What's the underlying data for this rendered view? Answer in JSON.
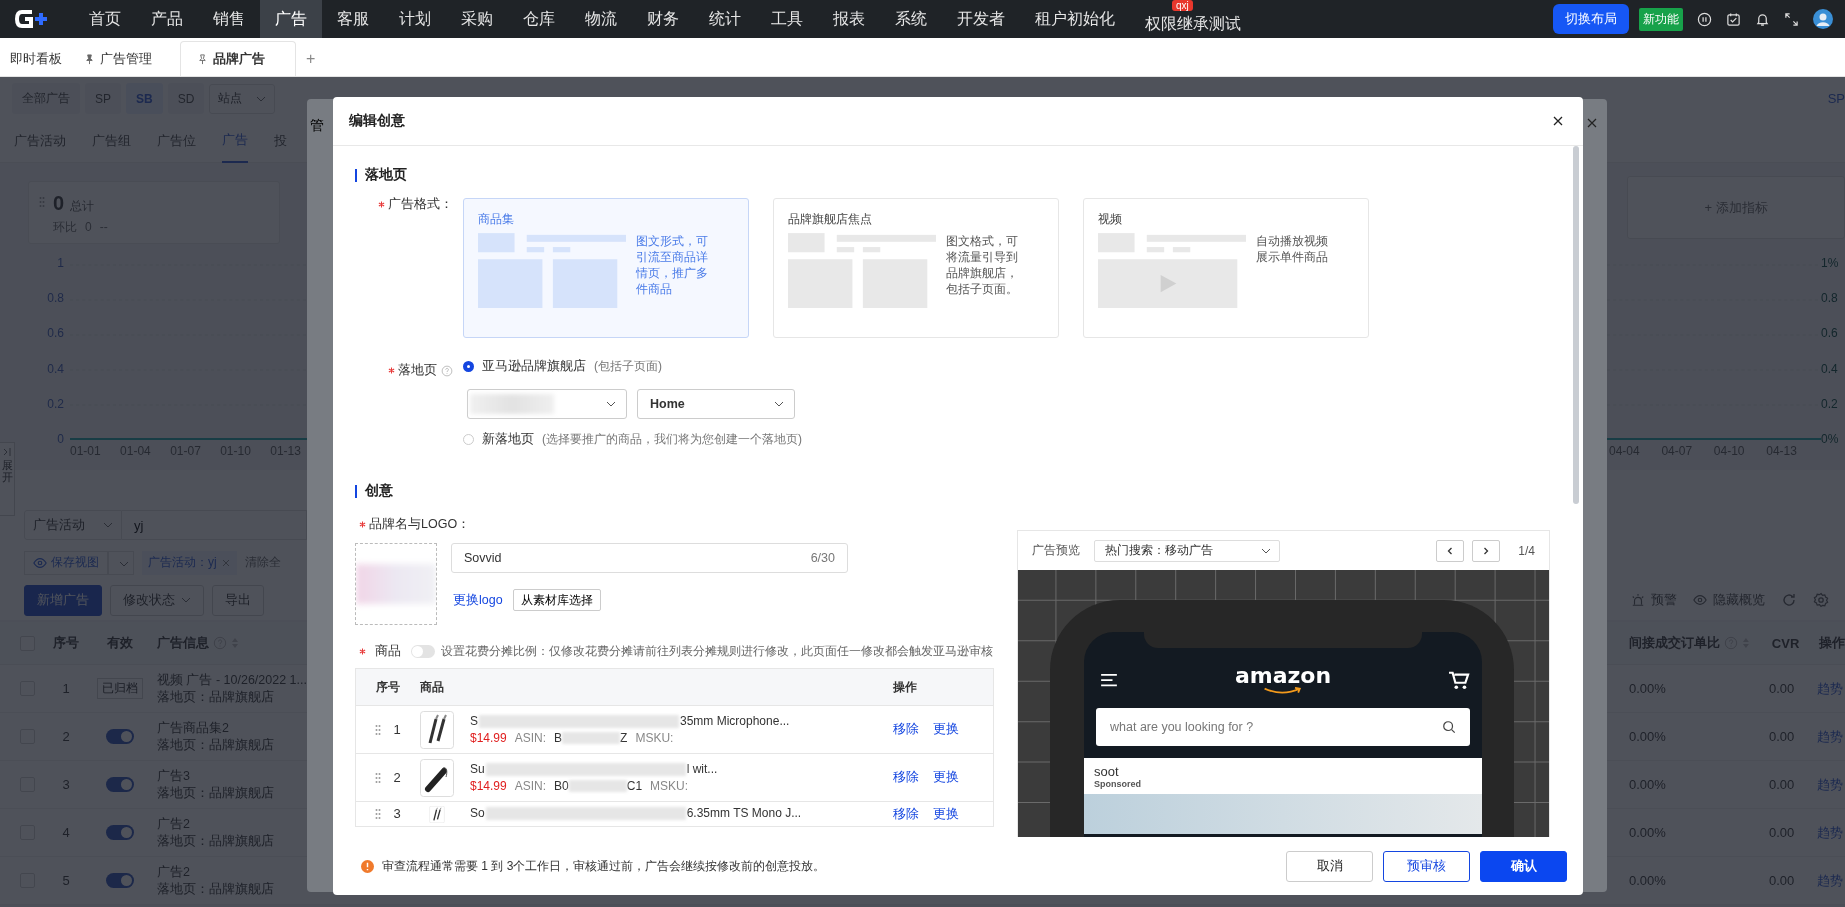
{
  "top_nav": {
    "items": [
      {
        "label": "首页",
        "selected": false
      },
      {
        "label": "产品",
        "selected": false
      },
      {
        "label": "销售",
        "selected": false
      },
      {
        "label": "广告",
        "selected": true
      },
      {
        "label": "客服",
        "selected": false
      },
      {
        "label": "计划",
        "selected": false
      },
      {
        "label": "采购",
        "selected": false
      },
      {
        "label": "仓库",
        "selected": false
      },
      {
        "label": "物流",
        "selected": false
      },
      {
        "label": "财务",
        "selected": false
      },
      {
        "label": "统计",
        "selected": false
      },
      {
        "label": "工具",
        "selected": false
      },
      {
        "label": "报表",
        "selected": false
      },
      {
        "label": "系统",
        "selected": false
      },
      {
        "label": "开发者",
        "selected": false
      },
      {
        "label": "租户初始化",
        "selected": false
      },
      {
        "label": "权限继承测试",
        "selected": false,
        "badge": "qxj"
      }
    ],
    "switch_layout": "切换布局",
    "new_feature": "新功能"
  },
  "page_tabs": [
    {
      "label": "即时看板",
      "pinned": false,
      "selected": false
    },
    {
      "label": "广告管理",
      "pinned": true,
      "selected": false
    },
    {
      "label": "品牌广告",
      "pinned": true,
      "selected": true
    }
  ],
  "add_tab": "+",
  "background": {
    "type_filters": [
      {
        "label": "全部广告",
        "selected": false
      },
      {
        "label": "SP",
        "selected": false
      },
      {
        "label": "SB",
        "selected": true
      },
      {
        "label": "SD",
        "selected": false
      }
    ],
    "site_select": "站点",
    "right_edge_text": "SP",
    "sub_tabs": [
      {
        "label": "广告活动",
        "selected": false
      },
      {
        "label": "广告组",
        "selected": false
      },
      {
        "label": "广告位",
        "selected": false
      },
      {
        "label": "广告",
        "selected": true
      },
      {
        "label": "投",
        "selected": false
      }
    ],
    "metric": {
      "value": "0",
      "label": "总计",
      "compare_label": "环比",
      "compare_value": "0",
      "compare_change": "--"
    },
    "add_metric": "+ 添加指标",
    "left_y_labels": [
      "1",
      "0.8",
      "0.6",
      "0.4",
      "0.2",
      "0"
    ],
    "left_x_labels": [
      "01-01",
      "01-04",
      "01-07",
      "01-10",
      "01-13"
    ],
    "right_y_labels": [
      "1%",
      "0.8",
      "0.6",
      "0.4",
      "0.2",
      "0%"
    ],
    "right_x_labels": [
      "04-04",
      "04-07",
      "04-10",
      "04-13"
    ],
    "expand_tab": "展开",
    "filter_field": "广告活动",
    "filter_value": "yj",
    "save_view": "保存视图",
    "filter_tag": "广告活动：yj",
    "clear_all": "清除全",
    "actions": [
      {
        "label": "新增广告",
        "kind": "primary"
      },
      {
        "label": "修改状态",
        "kind": "dropdown"
      },
      {
        "label": "导出",
        "kind": "default"
      }
    ],
    "toolbar": [
      {
        "label": "预警",
        "kind": "alarm"
      },
      {
        "label": "隐藏概览",
        "kind": "eye"
      },
      {
        "kind": "refresh"
      },
      {
        "kind": "settings"
      }
    ],
    "all_checked": false,
    "left_columns": [
      "序号",
      "有效",
      "广告信息"
    ],
    "right_columns": [
      "间接成交订单比",
      "CVR",
      "操作"
    ],
    "rows": [
      {
        "no": "1",
        "checked": false,
        "kind": "tag",
        "status": "已归档",
        "title": "视频 广告 - 10/26/2022 1...",
        "landing": "落地页：品牌旗舰店",
        "rate": "0.00%",
        "cvr": "0.00",
        "action": "趋势"
      },
      {
        "no": "2",
        "checked": false,
        "kind": "toggle",
        "on": true,
        "title": "广告商品集2",
        "landing": "落地页：品牌旗舰店",
        "rate": "0.00%",
        "cvr": "0.00",
        "action": "趋势"
      },
      {
        "no": "3",
        "checked": false,
        "kind": "toggle",
        "on": true,
        "title": "广告3",
        "landing": "落地页：品牌旗舰店",
        "rate": "0.00%",
        "cvr": "0.00",
        "action": "趋势"
      },
      {
        "no": "4",
        "checked": false,
        "kind": "toggle",
        "on": true,
        "title": "广告2",
        "landing": "落地页：品牌旗舰店",
        "rate": "0.00%",
        "cvr": "0.00",
        "action": "趋势"
      },
      {
        "no": "5",
        "checked": false,
        "kind": "toggle",
        "on": true,
        "title": "广告2",
        "landing": "落地页：品牌旗舰店",
        "rate": "0.00%",
        "cvr": "0.00",
        "action": "趋势"
      }
    ]
  },
  "back_modal": {
    "title": "管"
  },
  "modal": {
    "title": "编辑创意",
    "landing_section": {
      "title": "落地页",
      "format_label": "广告格式：",
      "format_required": true,
      "formats": [
        {
          "kind": "collection",
          "title": "商品集",
          "description": "图文形式，可引流至商品详情页，推广多件商品",
          "selected": true
        },
        {
          "kind": "spotlight",
          "title": "品牌旗舰店焦点",
          "description": "图文格式，可将流量引导到品牌旗舰店，包括子页面。",
          "selected": false
        },
        {
          "kind": "video",
          "title": "视频",
          "description": "自动播放视频展示单件商品",
          "selected": false
        }
      ],
      "landing_label": "落地页",
      "landing_required": true,
      "options": [
        {
          "label": "亚马逊品牌旗舰店",
          "hint": "(包括子页面)",
          "selected": true
        },
        {
          "label": "新落地页",
          "hint": "(选择要推广的商品，我们将为您创建一个落地页)",
          "selected": false
        }
      ],
      "page_select": "Home"
    },
    "creative_section": {
      "title": "创意",
      "brand_label": "品牌名与LOGO：",
      "brand_required": true,
      "brand_name": "Sovvid",
      "brand_count": "6/30",
      "change_logo": "更换logo",
      "library_button": "从素材库选择",
      "products_label": "商品",
      "products_required": true,
      "cost_split_on": false,
      "cost_split_text": "设置花费分摊比例：仅修改花费分摊请前往列表分摊规则进行修改，此页面任一修改都会触发亚马逊审核",
      "columns": [
        "序号",
        "商品",
        "操作"
      ],
      "products": [
        {
          "no": "1",
          "title_start": "S",
          "title_end": "35mm Microphone...",
          "price": "$14.99",
          "asin_label": "ASIN:",
          "asin_start": "B",
          "asin_end": "Z",
          "msku_label": "MSKU:",
          "actions": [
            "移除",
            "更换"
          ]
        },
        {
          "no": "2",
          "title_start": "Su",
          "title_end": "l wit...",
          "price": "$14.99",
          "asin_label": "ASIN:",
          "asin_start": "B0",
          "asin_end": "C1",
          "msku_label": "MSKU:",
          "actions": [
            "移除",
            "更换"
          ]
        },
        {
          "no": "3",
          "title_start": "So",
          "title_end": "6.35mm TS Mono J...",
          "actions": [
            "移除",
            "更换"
          ]
        }
      ]
    },
    "preview": {
      "label": "广告预览",
      "placement": "热门搜索：移动广告",
      "page": "1/4",
      "logo_text": "amazon",
      "search_placeholder": "what are you looking for ?",
      "brand": "soot",
      "sponsored": "Sponsored"
    },
    "notice": "审查流程通常需要 1 到 3个工作日，审核通过前，广告会继续按修改前的创意投放。",
    "buttons": [
      {
        "label": "取消",
        "kind": "default"
      },
      {
        "label": "预审核",
        "kind": "outline"
      },
      {
        "label": "确认",
        "kind": "primary"
      }
    ]
  }
}
